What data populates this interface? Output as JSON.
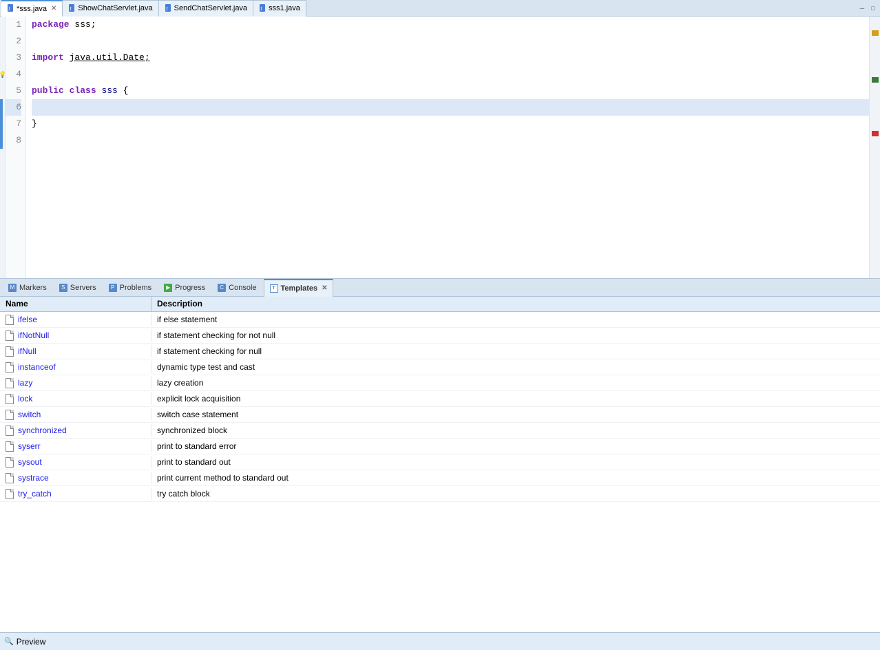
{
  "tabs": [
    {
      "label": "*sss.java",
      "icon": "java",
      "active": true,
      "closeable": true
    },
    {
      "label": "ShowChatServlet.java",
      "icon": "java",
      "active": false,
      "closeable": false
    },
    {
      "label": "SendChatServlet.java",
      "icon": "java",
      "active": false,
      "closeable": false
    },
    {
      "label": "sss1.java",
      "icon": "java",
      "active": false,
      "closeable": false
    }
  ],
  "editor": {
    "lines": [
      {
        "num": 1,
        "code": "package sss;",
        "style": "normal"
      },
      {
        "num": 2,
        "code": "",
        "style": "normal"
      },
      {
        "num": 3,
        "code": "import java.util.Date;",
        "style": "normal"
      },
      {
        "num": 4,
        "code": "",
        "style": "normal"
      },
      {
        "num": 5,
        "code": "public class sss {",
        "style": "blue-bar"
      },
      {
        "num": 6,
        "code": "",
        "style": "highlighted blue-bar"
      },
      {
        "num": 7,
        "code": "}",
        "style": "blue-bar"
      },
      {
        "num": 8,
        "code": "",
        "style": "normal"
      }
    ]
  },
  "panel_tabs": [
    {
      "id": "markers",
      "label": "Markers",
      "icon": "markers",
      "active": false
    },
    {
      "id": "servers",
      "label": "Servers",
      "icon": "servers",
      "active": false
    },
    {
      "id": "problems",
      "label": "Problems",
      "icon": "problems",
      "active": false
    },
    {
      "id": "progress",
      "label": "Progress",
      "icon": "progress",
      "active": false
    },
    {
      "id": "console",
      "label": "Console",
      "icon": "console",
      "active": false
    },
    {
      "id": "templates",
      "label": "Templates",
      "icon": "templates",
      "active": true
    }
  ],
  "templates": {
    "header": {
      "name_col": "Name",
      "desc_col": "Description"
    },
    "rows": [
      {
        "name": "ifelse",
        "description": "if else statement"
      },
      {
        "name": "ifNotNull",
        "description": "if statement checking for not null"
      },
      {
        "name": "ifNull",
        "description": "if statement checking for null"
      },
      {
        "name": "instanceof",
        "description": "dynamic type test and cast"
      },
      {
        "name": "lazy",
        "description": "lazy creation"
      },
      {
        "name": "lock",
        "description": "explicit lock acquisition"
      },
      {
        "name": "switch",
        "description": "switch case statement"
      },
      {
        "name": "synchronized",
        "description": "synchronized block"
      },
      {
        "name": "syserr",
        "description": "print to standard error"
      },
      {
        "name": "sysout",
        "description": "print to standard out"
      },
      {
        "name": "systrace",
        "description": "print current method to standard out"
      },
      {
        "name": "try_catch",
        "description": "try catch block"
      }
    ]
  },
  "preview": {
    "label": "Preview"
  }
}
